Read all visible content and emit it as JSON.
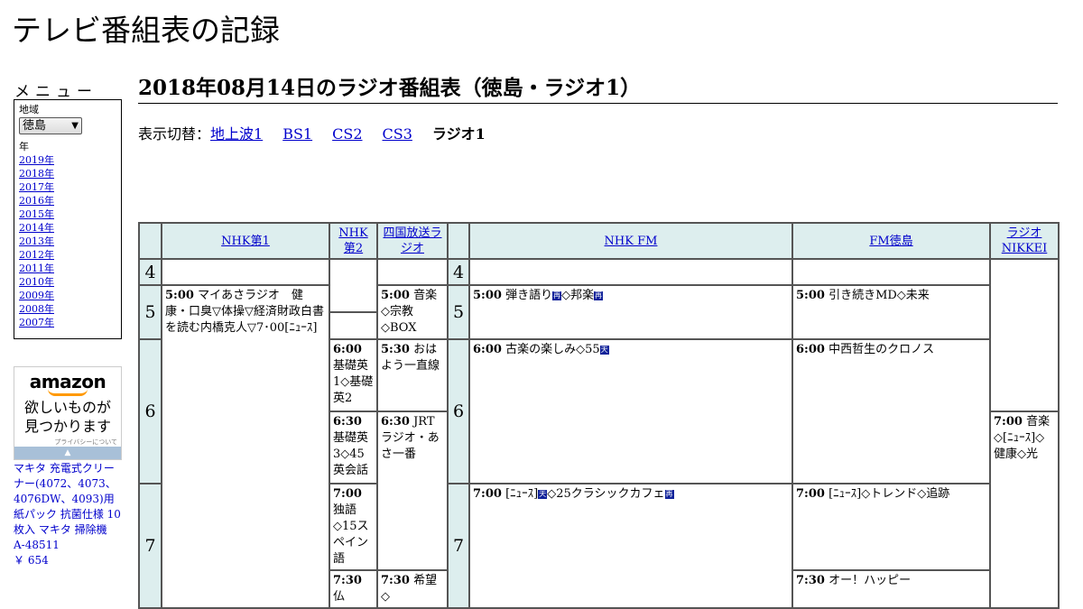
{
  "site_title": "テレビ番組表の記録",
  "menu": {
    "title": "メニュー",
    "region_label": "地域",
    "region_value": "徳島",
    "year_label": "年",
    "years": [
      "2019年",
      "2018年",
      "2017年",
      "2016年",
      "2015年",
      "2014年",
      "2013年",
      "2012年",
      "2011年",
      "2010年",
      "2009年",
      "2008年",
      "2007年"
    ]
  },
  "ad": {
    "logo": "amazon",
    "copy_line1": "欲しいものが",
    "copy_line2": "見つかります",
    "privacy": "プライバシーについて",
    "product_text": "マキタ 充電式クリーナー(4072、4073、4076DW、4093)用 紙パック 抗菌仕様 10枚入 マキタ 掃除機 A-48511",
    "price": "￥ 654"
  },
  "heading": "2018年08月14日のラジオ番組表（徳島・ラジオ1）",
  "switcher": {
    "label": "表示切替：",
    "links": [
      "地上波1",
      "BS1",
      "CS2",
      "CS3"
    ],
    "current": "ラジオ1"
  },
  "table": {
    "channels": [
      "NHK第1",
      "NHK第2",
      "四国放送ラジオ",
      "NHK FM",
      "FM徳島",
      "ラジオNIKKEI"
    ],
    "hours": [
      "4",
      "5",
      "6",
      "7",
      "4",
      "5",
      "6",
      "7"
    ],
    "programs": {
      "nhk1_500_time": "5:00",
      "nhk1_500_title": "マイあさラジオ　健康・口臭▽体操▽経済財政白書を読む内橋克人▽7･00[ﾆｭｰｽ]",
      "nhk2_600_time": "6:00",
      "nhk2_600_title": "基礎英1◇基礎英2",
      "nhk2_630_time": "6:30",
      "nhk2_630_title": "基礎英3◇45英会話",
      "nhk2_700_time": "7:00",
      "nhk2_700_title": "独語◇15スペイン語",
      "nhk2_730_time": "7:30",
      "nhk2_730_title": "仏",
      "shikoku_500_time": "5:00",
      "shikoku_500_title": "音楽◇宗教◇BOX",
      "shikoku_530_time": "5:30",
      "shikoku_530_title": "おはよう一直線",
      "shikoku_630_time": "6:30",
      "shikoku_630_title": "JRTラジオ・あさ一番",
      "shikoku_730_time": "7:30",
      "shikoku_730_title": "希望◇",
      "nhkfm_500_time": "5:00",
      "nhkfm_500_title_a": "弾き語り",
      "nhkfm_500_title_b": "◇邦楽",
      "nhkfm_600_time": "6:00",
      "nhkfm_600_title": "古楽の楽しみ◇55",
      "nhkfm_700_time": "7:00",
      "nhkfm_700_title_a": "[ﾆｭｰｽ]",
      "nhkfm_700_title_b": "◇25クラシックカフェ",
      "fmt_500_time": "5:00",
      "fmt_500_title": "引き続きMD◇未来",
      "fmt_600_time": "6:00",
      "fmt_600_title": "中西哲生のクロノス",
      "fmt_700_time": "7:00",
      "fmt_700_title": "[ﾆｭｰｽ]◇トレンド◇追跡",
      "fmt_730_time": "7:30",
      "fmt_730_title": "オー！ハッピー",
      "nikkei_700_time": "7:00",
      "nikkei_700_title": "音楽◇[ﾆｭｰｽ]◇健康◇光"
    },
    "marks": {
      "rebroadcast": "再",
      "weather": "天"
    }
  }
}
